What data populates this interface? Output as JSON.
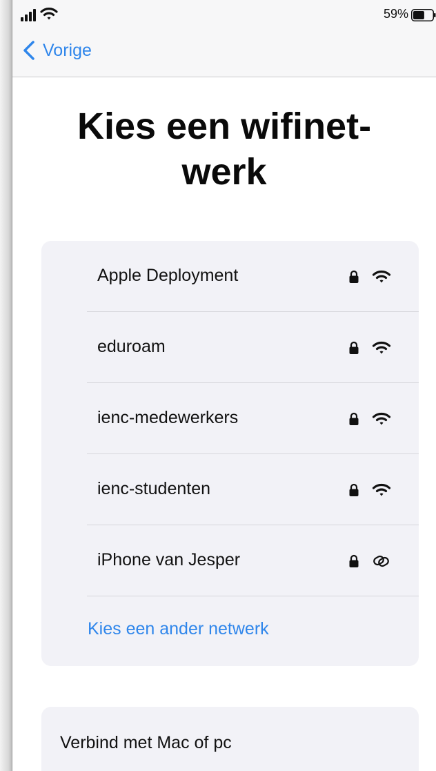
{
  "status_bar": {
    "signal_icon": "cellular-signal-icon",
    "wifi_icon": "wifi-icon",
    "battery_percent": "59%",
    "battery_level": 0.59
  },
  "nav": {
    "back_label": "Vorige",
    "back_icon": "chevron-back-icon"
  },
  "page": {
    "title_line1": "Kies een wifinet-",
    "title_line2": "werk"
  },
  "networks": [
    {
      "name": "Apple Deployment",
      "icon": "wifi-icon",
      "locked": true
    },
    {
      "name": "eduroam",
      "icon": "wifi-icon",
      "locked": true
    },
    {
      "name": "ienc-medewerkers",
      "icon": "wifi-icon",
      "locked": true
    },
    {
      "name": "ienc-studenten",
      "icon": "wifi-icon",
      "locked": true
    },
    {
      "name": "iPhone van Jesper",
      "icon": "personal-hotspot-icon",
      "locked": true
    }
  ],
  "other_network_label": "Kies een ander netwerk",
  "connect_mac_label": "Verbind met Mac of pc",
  "colors": {
    "accent": "#2f86eb",
    "card_background": "#f2f2f7",
    "text": "#111111"
  }
}
